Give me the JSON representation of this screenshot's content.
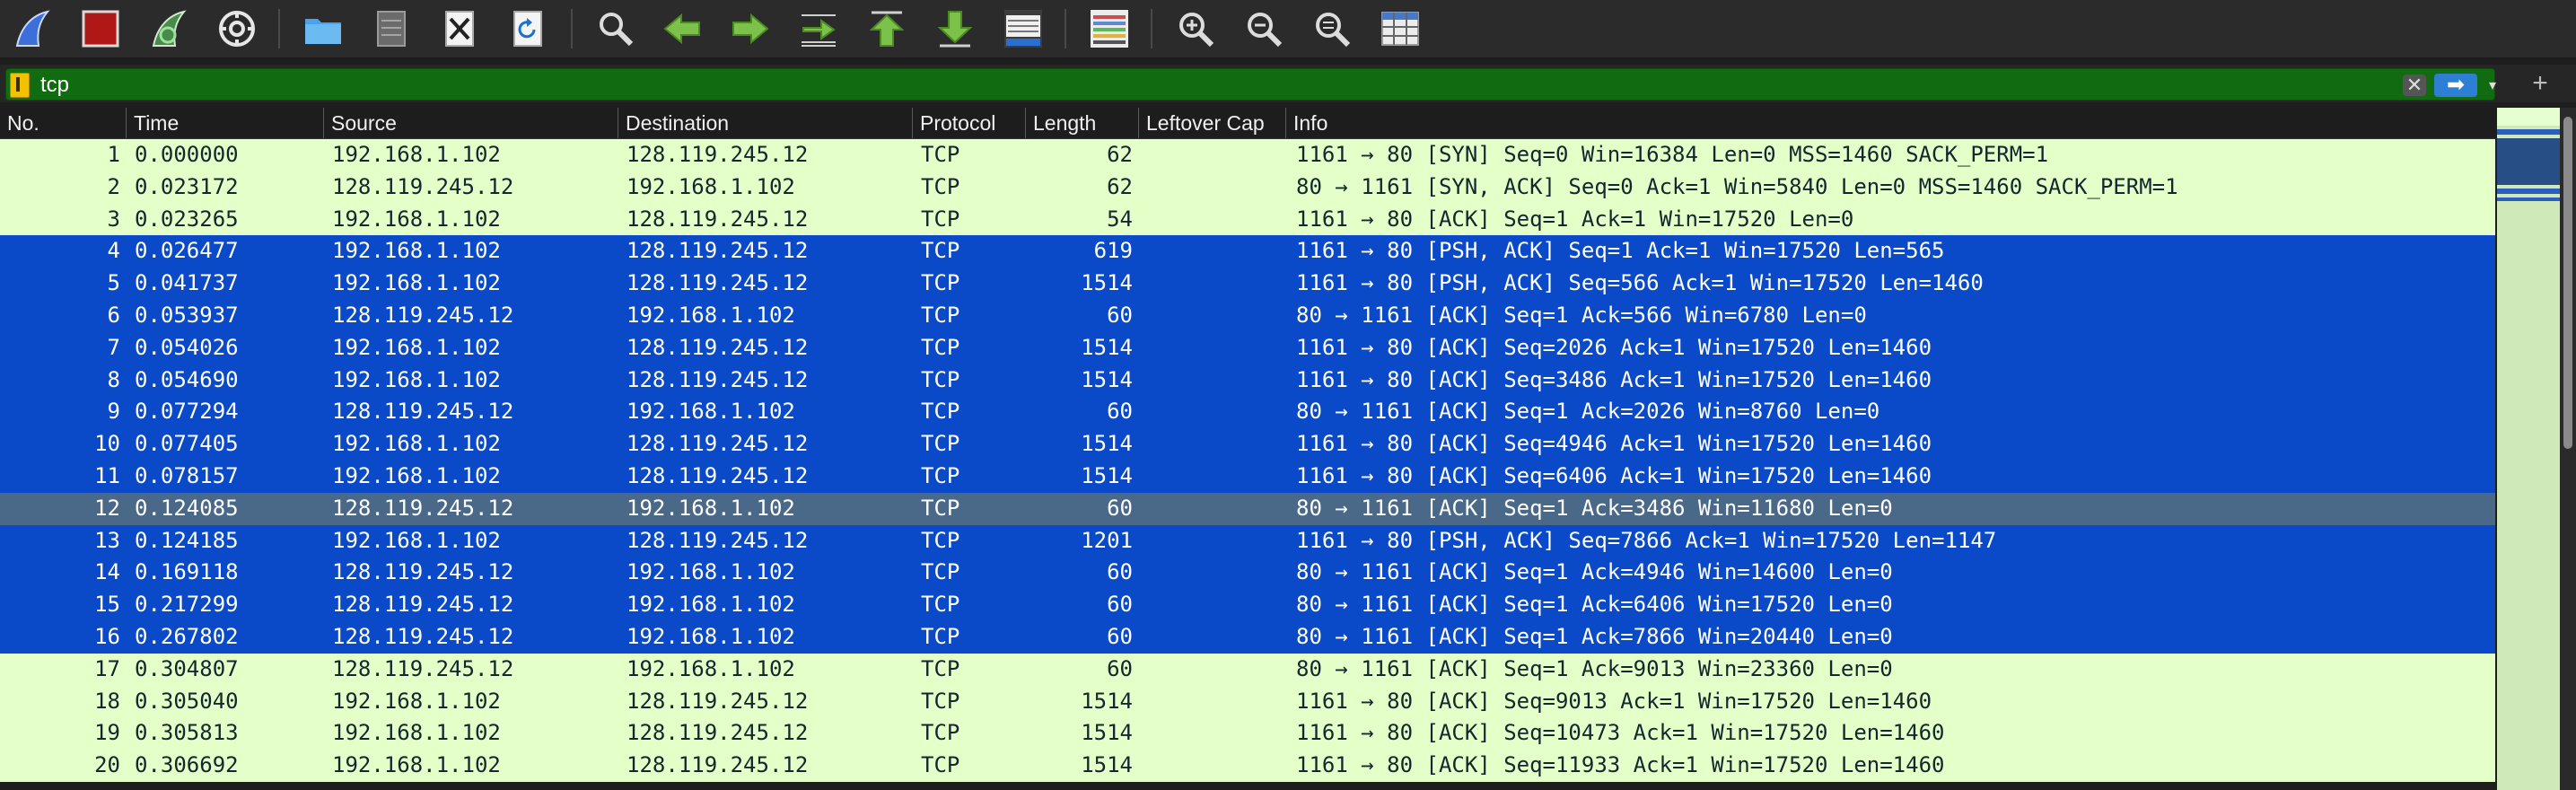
{
  "toolbar": {
    "icons": [
      "shark-fin-start-icon",
      "stop-capture-icon",
      "restart-capture-icon",
      "capture-options-icon",
      "open-folder-icon",
      "save-file-icon",
      "close-file-icon",
      "reload-file-icon",
      "find-packet-icon",
      "go-back-icon",
      "go-forward-icon",
      "go-to-packet-icon",
      "go-first-packet-icon",
      "go-last-packet-icon",
      "autoscroll-icon",
      "colorize-icon",
      "zoom-in-icon",
      "zoom-out-icon",
      "zoom-normal-icon",
      "resize-columns-icon"
    ]
  },
  "filter": {
    "value": "tcp",
    "clear_label": "✕",
    "apply_label": "➡",
    "dropdown_label": "▾",
    "add_label": "+"
  },
  "columns": {
    "no": "No.",
    "time": "Time",
    "source": "Source",
    "destination": "Destination",
    "protocol": "Protocol",
    "length": "Length",
    "leftover": "Leftover Cap",
    "info": "Info"
  },
  "colors": {
    "row_green": "#e4ffc7",
    "row_blue": "#0a49c8",
    "row_selected": "#4a6888",
    "filter_valid": "#116b11"
  },
  "packets": [
    {
      "no": "1",
      "time": "0.000000",
      "source": "192.168.1.102",
      "destination": "128.119.245.12",
      "protocol": "TCP",
      "length": "62",
      "leftover": "",
      "info": "1161 → 80 [SYN] Seq=0 Win=16384 Len=0 MSS=1460 SACK_PERM=1",
      "style": "green"
    },
    {
      "no": "2",
      "time": "0.023172",
      "source": "128.119.245.12",
      "destination": "192.168.1.102",
      "protocol": "TCP",
      "length": "62",
      "leftover": "",
      "info": "80 → 1161 [SYN, ACK] Seq=0 Ack=1 Win=5840 Len=0 MSS=1460 SACK_PERM=1",
      "style": "green"
    },
    {
      "no": "3",
      "time": "0.023265",
      "source": "192.168.1.102",
      "destination": "128.119.245.12",
      "protocol": "TCP",
      "length": "54",
      "leftover": "",
      "info": "1161 → 80 [ACK] Seq=1 Ack=1 Win=17520 Len=0",
      "style": "green"
    },
    {
      "no": "4",
      "time": "0.026477",
      "source": "192.168.1.102",
      "destination": "128.119.245.12",
      "protocol": "TCP",
      "length": "619",
      "leftover": "",
      "info": "1161 → 80 [PSH, ACK] Seq=1 Ack=1 Win=17520 Len=565",
      "style": "blue"
    },
    {
      "no": "5",
      "time": "0.041737",
      "source": "192.168.1.102",
      "destination": "128.119.245.12",
      "protocol": "TCP",
      "length": "1514",
      "leftover": "",
      "info": "1161 → 80 [PSH, ACK] Seq=566 Ack=1 Win=17520 Len=1460",
      "style": "blue"
    },
    {
      "no": "6",
      "time": "0.053937",
      "source": "128.119.245.12",
      "destination": "192.168.1.102",
      "protocol": "TCP",
      "length": "60",
      "leftover": "",
      "info": "80 → 1161 [ACK] Seq=1 Ack=566 Win=6780 Len=0",
      "style": "blue"
    },
    {
      "no": "7",
      "time": "0.054026",
      "source": "192.168.1.102",
      "destination": "128.119.245.12",
      "protocol": "TCP",
      "length": "1514",
      "leftover": "",
      "info": "1161 → 80 [ACK] Seq=2026 Ack=1 Win=17520 Len=1460",
      "style": "blue"
    },
    {
      "no": "8",
      "time": "0.054690",
      "source": "192.168.1.102",
      "destination": "128.119.245.12",
      "protocol": "TCP",
      "length": "1514",
      "leftover": "",
      "info": "1161 → 80 [ACK] Seq=3486 Ack=1 Win=17520 Len=1460",
      "style": "blue"
    },
    {
      "no": "9",
      "time": "0.077294",
      "source": "128.119.245.12",
      "destination": "192.168.1.102",
      "protocol": "TCP",
      "length": "60",
      "leftover": "",
      "info": "80 → 1161 [ACK] Seq=1 Ack=2026 Win=8760 Len=0",
      "style": "blue"
    },
    {
      "no": "10",
      "time": "0.077405",
      "source": "192.168.1.102",
      "destination": "128.119.245.12",
      "protocol": "TCP",
      "length": "1514",
      "leftover": "",
      "info": "1161 → 80 [ACK] Seq=4946 Ack=1 Win=17520 Len=1460",
      "style": "blue"
    },
    {
      "no": "11",
      "time": "0.078157",
      "source": "192.168.1.102",
      "destination": "128.119.245.12",
      "protocol": "TCP",
      "length": "1514",
      "leftover": "",
      "info": "1161 → 80 [ACK] Seq=6406 Ack=1 Win=17520 Len=1460",
      "style": "blue"
    },
    {
      "no": "12",
      "time": "0.124085",
      "source": "128.119.245.12",
      "destination": "192.168.1.102",
      "protocol": "TCP",
      "length": "60",
      "leftover": "",
      "info": "80 → 1161 [ACK] Seq=1 Ack=3486 Win=11680 Len=0",
      "style": "sel"
    },
    {
      "no": "13",
      "time": "0.124185",
      "source": "192.168.1.102",
      "destination": "128.119.245.12",
      "protocol": "TCP",
      "length": "1201",
      "leftover": "",
      "info": "1161 → 80 [PSH, ACK] Seq=7866 Ack=1 Win=17520 Len=1147",
      "style": "blue"
    },
    {
      "no": "14",
      "time": "0.169118",
      "source": "128.119.245.12",
      "destination": "192.168.1.102",
      "protocol": "TCP",
      "length": "60",
      "leftover": "",
      "info": "80 → 1161 [ACK] Seq=1 Ack=4946 Win=14600 Len=0",
      "style": "blue"
    },
    {
      "no": "15",
      "time": "0.217299",
      "source": "128.119.245.12",
      "destination": "192.168.1.102",
      "protocol": "TCP",
      "length": "60",
      "leftover": "",
      "info": "80 → 1161 [ACK] Seq=1 Ack=6406 Win=17520 Len=0",
      "style": "blue"
    },
    {
      "no": "16",
      "time": "0.267802",
      "source": "128.119.245.12",
      "destination": "192.168.1.102",
      "protocol": "TCP",
      "length": "60",
      "leftover": "",
      "info": "80 → 1161 [ACK] Seq=1 Ack=7866 Win=20440 Len=0",
      "style": "blue"
    },
    {
      "no": "17",
      "time": "0.304807",
      "source": "128.119.245.12",
      "destination": "192.168.1.102",
      "protocol": "TCP",
      "length": "60",
      "leftover": "",
      "info": "80 → 1161 [ACK] Seq=1 Ack=9013 Win=23360 Len=0",
      "style": "green"
    },
    {
      "no": "18",
      "time": "0.305040",
      "source": "192.168.1.102",
      "destination": "128.119.245.12",
      "protocol": "TCP",
      "length": "1514",
      "leftover": "",
      "info": "1161 → 80 [ACK] Seq=9013 Ack=1 Win=17520 Len=1460",
      "style": "green"
    },
    {
      "no": "19",
      "time": "0.305813",
      "source": "192.168.1.102",
      "destination": "128.119.245.12",
      "protocol": "TCP",
      "length": "1514",
      "leftover": "",
      "info": "1161 → 80 [ACK] Seq=10473 Ack=1 Win=17520 Len=1460",
      "style": "green"
    },
    {
      "no": "20",
      "time": "0.306692",
      "source": "192.168.1.102",
      "destination": "128.119.245.12",
      "protocol": "TCP",
      "length": "1514",
      "leftover": "",
      "info": "1161 → 80 [ACK] Seq=11933 Ack=1 Win=17520 Len=1460",
      "style": "green"
    }
  ]
}
